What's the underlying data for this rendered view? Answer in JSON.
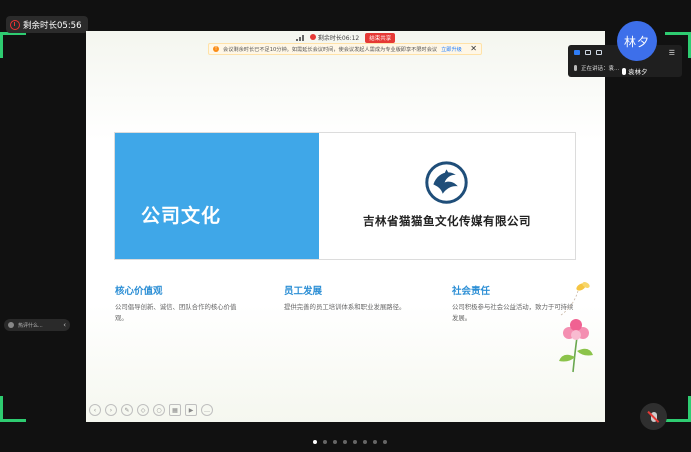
{
  "meeting": {
    "remaining_label": "剩余时长05:56",
    "share_remaining": "剩余时长06:12",
    "end_share_label": "结束共享",
    "notice_text": "会议剩余时长已不足10分钟。如需延长会议时间，使会议发起人需成为专业版即享不限时会议",
    "notice_link": "立即升级",
    "notice_close": "✕"
  },
  "slide": {
    "title": "公司文化",
    "company": "吉林省猫猫鱼文化传媒有限公司",
    "columns": [
      {
        "heading": "核心价值观",
        "body": "公司倡导创新、诚信、团队合作的核心价值观。"
      },
      {
        "heading": "员工发展",
        "body": "提供完善的员工培训体系和职业发展路径。"
      },
      {
        "heading": "社会责任",
        "body": "公司积极参与社会公益活动，致力于可持续发展。"
      }
    ]
  },
  "participant": {
    "avatar_text": "林夕",
    "name": "袁林夕",
    "speaking_label": "正在讲话：袁..."
  },
  "chat": {
    "preview": "热评什么..."
  },
  "colors": {
    "accent_blue": "#3fa7e8",
    "avatar_blue": "#3d6fea",
    "speaker_green": "#2ecc71",
    "alert_red": "#e53935"
  }
}
